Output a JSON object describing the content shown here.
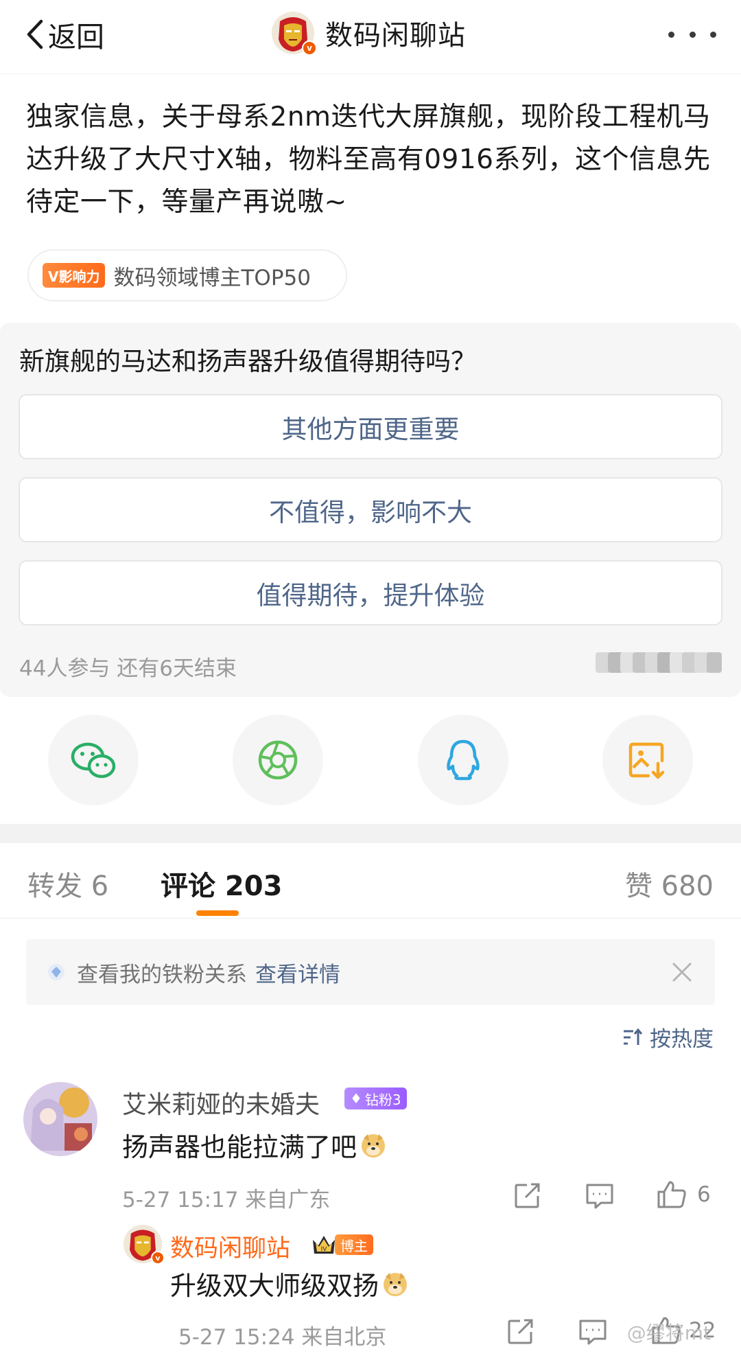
{
  "header": {
    "back_label": "返回",
    "title": "数码闲聊站"
  },
  "post": {
    "text": "独家信息，关于母系2nm迭代大屏旗舰，现阶段工程机马达升级了大尺寸X轴，物料至高有0916系列，这个信息先待定一下，等量产再说嗷~",
    "tag_badge": "V影响力",
    "tag_text": "数码领域博主TOP50"
  },
  "poll": {
    "question": "新旗舰的马达和扬声器升级值得期待吗？",
    "options": [
      "其他方面更重要",
      "不值得，影响不大",
      "值得期待，提升体验"
    ],
    "footer": "44人参与 还有6天结束"
  },
  "share": {
    "icons": [
      "wechat-icon",
      "moments-icon",
      "qq-icon",
      "save-image-icon"
    ]
  },
  "tabs": {
    "repost": "转发 6",
    "comments": "评论 203",
    "likes": "赞 680"
  },
  "iron_fans": {
    "text": "查看我的铁粉关系",
    "link": "查看详情"
  },
  "sort": {
    "label": "按热度"
  },
  "comment": {
    "name": "艾米莉娅的未婚夫",
    "badge": "钻粉3",
    "text": "扬声器也能拉满了吧",
    "meta": "5-27 15:17 来自广东",
    "like_count": "6"
  },
  "reply": {
    "name": "数码闲聊站",
    "badge": "博主",
    "text": "升级双大师级双扬",
    "meta": "5-27 15:24 来自北京",
    "like_count": "22"
  },
  "watermark": "@缪将mt",
  "colors": {
    "accent_orange": "#ff8200",
    "link_blue": "#4f6689",
    "wechat_green": "#2aae67",
    "moments_green": "#5fbf5b",
    "qq_blue": "#2ea7e0",
    "save_orange": "#f5a623"
  }
}
